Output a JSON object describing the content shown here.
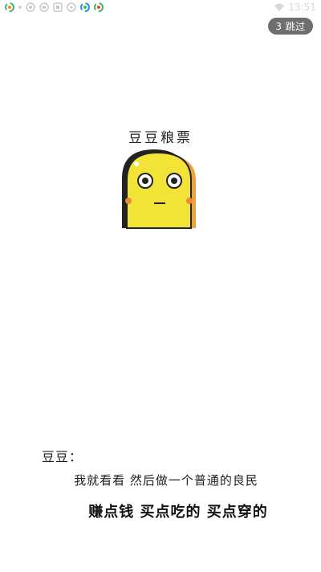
{
  "status_bar": {
    "time": "13:51",
    "left_icons": [
      "sync-icon",
      "dot-icon",
      "camera-icon",
      "chat-icon",
      "box-icon",
      "message-icon",
      "sync-icon",
      "sync-icon"
    ],
    "right_icons": [
      "wifi-icon"
    ]
  },
  "skip": {
    "countdown": "3",
    "label": "跳过"
  },
  "logo": {
    "title": "豆豆粮票"
  },
  "quote": {
    "speaker": "豆豆：",
    "line1": "我就看看 然后做一个普通的良民",
    "line2": "赚点钱 买点吃的 买点穿的"
  },
  "colors": {
    "background": "#ffffff",
    "mascot_body": "#f2e436",
    "mascot_outline": "#222222",
    "mascot_cheek": "#e8893a",
    "skip_bg": "#6e6e6e"
  }
}
